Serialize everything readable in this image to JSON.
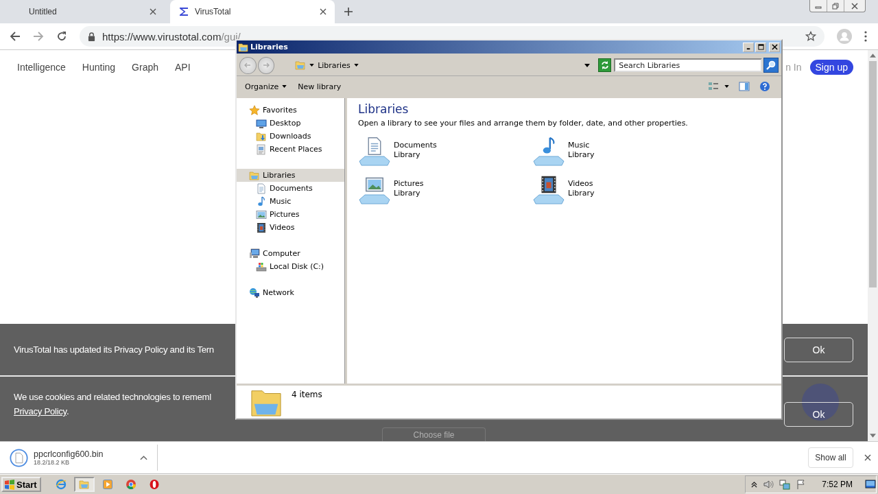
{
  "browser": {
    "tabs": [
      {
        "title": "Untitled",
        "selected": false
      },
      {
        "title": "VirusTotal",
        "selected": true
      }
    ],
    "url": {
      "host": "https://www.virustotal.com",
      "path": "/gui/"
    }
  },
  "page": {
    "nav": [
      "Intelligence",
      "Hunting",
      "Graph",
      "API"
    ],
    "sign_in": "n In",
    "sign_up": "Sign up",
    "banners": [
      {
        "text": "VirusTotal has updated its Privacy Policy and its Tern",
        "button": "Ok"
      },
      {
        "text": "We use cookies and related technologies to rememl",
        "link": "Privacy Policy",
        "after": ".",
        "button": "Ok"
      }
    ],
    "choose_file": "Choose file"
  },
  "downloads": {
    "items": [
      {
        "name": "ppcrlconfig600.bin",
        "size": "18.2/18.2 KB"
      }
    ],
    "show_all": "Show all"
  },
  "explorer": {
    "title": "Libraries",
    "address": "Libraries",
    "search": {
      "placeholder": "Search Libraries"
    },
    "commands": [
      {
        "label": "Organize",
        "menu": true
      },
      {
        "label": "New library",
        "menu": false
      }
    ],
    "nav": [
      {
        "label": "Favorites",
        "kind": "star",
        "selected": false,
        "children": [
          {
            "label": "Desktop",
            "kind": "desktop",
            "selected": false
          },
          {
            "label": "Downloads",
            "kind": "download",
            "selected": false
          },
          {
            "label": "Recent Places",
            "kind": "recent",
            "selected": false
          }
        ]
      },
      {
        "label": "Libraries",
        "kind": "library",
        "selected": true,
        "children": [
          {
            "label": "Documents",
            "kind": "document",
            "selected": false
          },
          {
            "label": "Music",
            "kind": "music",
            "selected": false
          },
          {
            "label": "Pictures",
            "kind": "picture",
            "selected": false
          },
          {
            "label": "Videos",
            "kind": "video",
            "selected": false
          }
        ]
      },
      {
        "label": "Computer",
        "kind": "computer",
        "selected": false,
        "children": [
          {
            "label": "Local Disk (C:)",
            "kind": "disk",
            "selected": false
          }
        ]
      },
      {
        "label": "Network",
        "kind": "network",
        "selected": false
      }
    ],
    "heading": "Libraries",
    "description": "Open a library to see your files and arrange them by folder, date, and other properties.",
    "libraries": [
      {
        "kind": "document",
        "name": "Documents",
        "type": "Library"
      },
      {
        "kind": "music",
        "name": "Music",
        "type": "Library"
      },
      {
        "kind": "picture",
        "name": "Pictures",
        "type": "Library"
      },
      {
        "kind": "video",
        "name": "Videos",
        "type": "Library"
      }
    ],
    "status": "4 items"
  },
  "taskbar": {
    "start": "Start",
    "apps": [
      {
        "kind": "ie",
        "selected": false
      },
      {
        "kind": "explorer",
        "selected": true
      },
      {
        "kind": "media",
        "selected": false
      },
      {
        "kind": "chrome",
        "selected": false
      },
      {
        "kind": "opera",
        "selected": false
      }
    ],
    "clock": "7:52 PM"
  }
}
